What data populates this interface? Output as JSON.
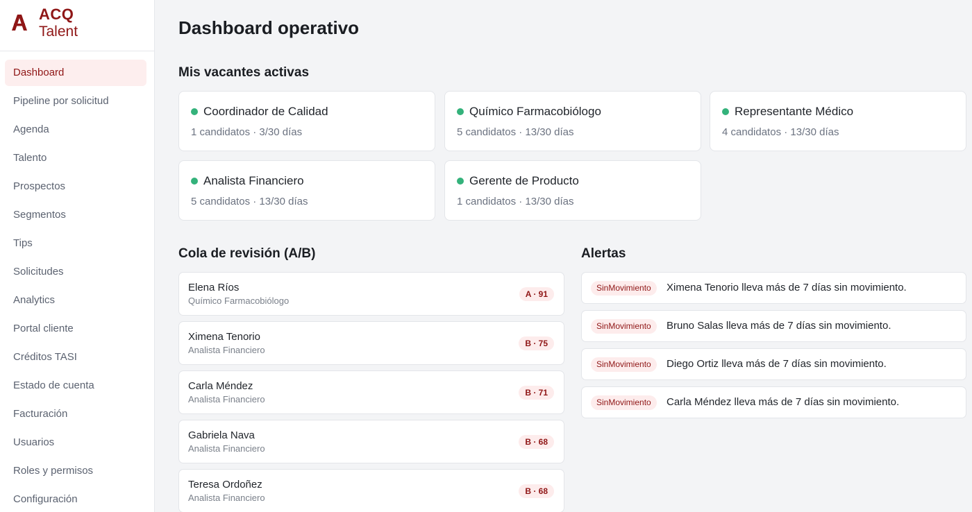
{
  "brand": {
    "name_top": "ACQ",
    "name_bottom": "Talent"
  },
  "nav": [
    {
      "label": "Dashboard",
      "active": true
    },
    {
      "label": "Pipeline por solicitud"
    },
    {
      "label": "Agenda"
    },
    {
      "label": "Talento"
    },
    {
      "label": "Prospectos"
    },
    {
      "label": "Segmentos"
    },
    {
      "label": "Tips"
    },
    {
      "label": "Solicitudes"
    },
    {
      "label": "Analytics"
    },
    {
      "label": "Portal cliente"
    },
    {
      "label": "Créditos TASI"
    },
    {
      "label": "Estado de cuenta"
    },
    {
      "label": "Facturación"
    },
    {
      "label": "Usuarios"
    },
    {
      "label": "Roles y permisos"
    },
    {
      "label": "Configuración"
    }
  ],
  "page_title": "Dashboard operativo",
  "vacantes": {
    "title": "Mis vacantes activas",
    "status_color": "#34b27b",
    "items": [
      {
        "title": "Coordinador de Calidad",
        "meta": "1 candidatos · 3/30 días"
      },
      {
        "title": "Químico Farmacobiólogo",
        "meta": "5 candidatos · 13/30 días"
      },
      {
        "title": "Representante Médico",
        "meta": "4 candidatos · 13/30 días"
      },
      {
        "title": "Analista Financiero",
        "meta": "5 candidatos · 13/30 días"
      },
      {
        "title": "Gerente de Producto",
        "meta": "1 candidatos · 13/30 días"
      }
    ]
  },
  "revision": {
    "title": "Cola de revisión (A/B)",
    "items": [
      {
        "name": "Elena Ríos",
        "role": "Químico Farmacobiólogo",
        "score": "A · 91"
      },
      {
        "name": "Ximena Tenorio",
        "role": "Analista Financiero",
        "score": "B · 75"
      },
      {
        "name": "Carla Méndez",
        "role": "Analista Financiero",
        "score": "B · 71"
      },
      {
        "name": "Gabriela Nava",
        "role": "Analista Financiero",
        "score": "B · 68"
      },
      {
        "name": "Teresa Ordoñez",
        "role": "Analista Financiero",
        "score": "B · 68"
      }
    ]
  },
  "alertas": {
    "title": "Alertas",
    "items": [
      {
        "badge": "SinMovimiento",
        "text": "Ximena Tenorio lleva más de 7 días sin movimiento."
      },
      {
        "badge": "SinMovimiento",
        "text": "Bruno Salas lleva más de 7 días sin movimiento."
      },
      {
        "badge": "SinMovimiento",
        "text": "Diego Ortiz lleva más de 7 días sin movimiento."
      },
      {
        "badge": "SinMovimiento",
        "text": "Carla Méndez lleva más de 7 días sin movimiento."
      }
    ]
  },
  "colors": {
    "brand": "#8f1616",
    "badge_bg": "#fdecec"
  }
}
